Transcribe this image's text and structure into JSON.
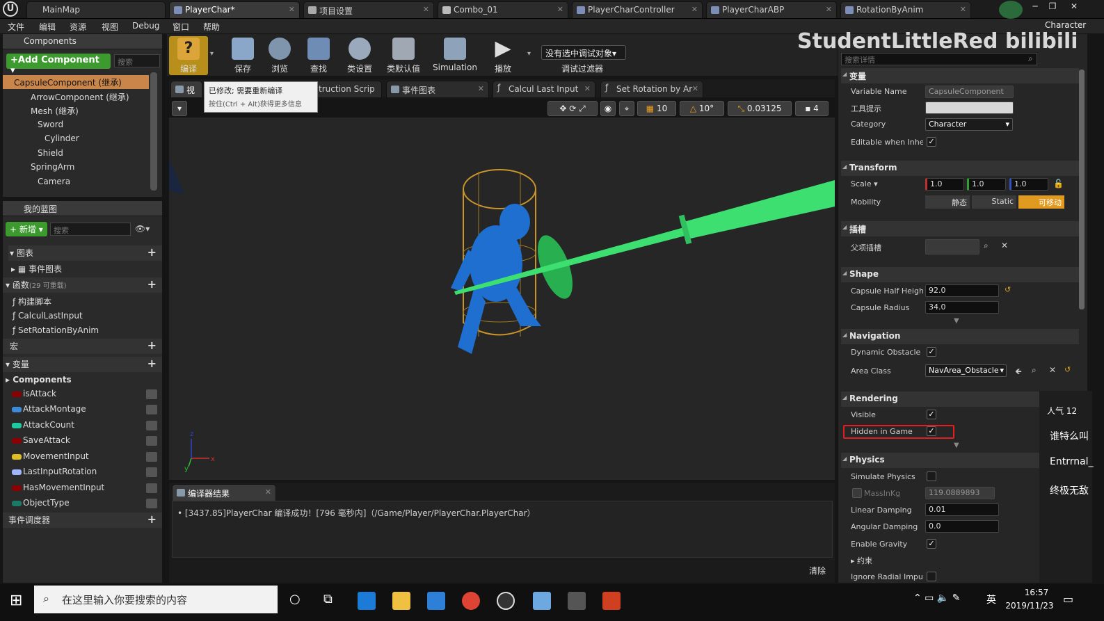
{
  "tabs": [
    "MainMap",
    "PlayerChar*",
    "项目设置",
    "Combo_01",
    "PlayerCharController",
    "PlayerCharABP",
    "RotationByAnim"
  ],
  "parent_class": "Character",
  "watermark": "StudentLittleRed bilibili",
  "menus": [
    "文件",
    "编辑",
    "资源",
    "视图",
    "Debug",
    "窗口",
    "帮助"
  ],
  "components": {
    "title": "Components",
    "add_label": "+Add Component ▾",
    "search_placeholder": "搜索",
    "tree": [
      "CapsuleComponent (继承)",
      "ArrowComponent (继承)",
      "Mesh (继承)",
      "Sword",
      "Cylinder",
      "Shield",
      "SpringArm",
      "Camera"
    ]
  },
  "myblueprint": {
    "title": "我的蓝图",
    "new_label": "新增",
    "search_placeholder": "搜索",
    "graphs": "图表",
    "event_graph": "事件图表",
    "functions": "函数",
    "functions_count": "(29 可重载)",
    "function_items": [
      "构建脚本",
      "CalculLastInput",
      "SetRotationByAnim"
    ],
    "macros": "宏",
    "variables": "变量",
    "components_cat": "Components",
    "vars": [
      {
        "name": "isAttack",
        "color": "#8b0000"
      },
      {
        "name": "AttackMontage",
        "color": "#3d8bd9"
      },
      {
        "name": "AttackCount",
        "color": "#1fc9a0"
      },
      {
        "name": "SaveAttack",
        "color": "#8b0000"
      },
      {
        "name": "MovementInput",
        "color": "#e0c020"
      },
      {
        "name": "LastInputRotation",
        "color": "#a0b4ff"
      },
      {
        "name": "HasMovementInput",
        "color": "#8b0000"
      },
      {
        "name": "ObjectType",
        "color": "#1a7a66"
      }
    ],
    "dispatchers": "事件调度器"
  },
  "toolbar": {
    "compile": "编译",
    "save": "保存",
    "browse": "浏览",
    "find": "查找",
    "class_settings": "类设置",
    "class_defaults": "类默认值",
    "simulation": "Simulation",
    "play": "播放",
    "debug_object": "没有选中调试对象▾",
    "debug_filter": "调试过滤器"
  },
  "tooltip": {
    "line1": "已修改; 需要重新编译",
    "line2": "按住(Ctrl + Alt)获得更多信息"
  },
  "editor_tabs": [
    "视",
    "truction Scrip",
    "事件图表",
    "Calcul Last Input",
    "Set Rotation by Ar"
  ],
  "viewport_controls": {
    "grid": "10",
    "angle": "10°",
    "scale": "0.03125",
    "camera_speed": "4"
  },
  "axis": {
    "x": "x",
    "y": "y",
    "z": "z"
  },
  "compiler": {
    "title": "编译器结果",
    "message": "[3437.85]PlayerChar 编译成功！[796 毫秒内]（/Game/Player/PlayerChar.PlayerChar）",
    "clear": "清除"
  },
  "details": {
    "search_placeholder": "搜索详情",
    "sec_variable": "变量",
    "variable_name_label": "Variable Name",
    "variable_name": "CapsuleComponent",
    "tooltip_label": "工具提示",
    "category_label": "Category",
    "category": "Character",
    "editable_label": "Editable when Inher",
    "sec_transform": "Transform",
    "scale_label": "Scale ▾",
    "scale": [
      "1.0",
      "1.0",
      "1.0"
    ],
    "mobility_label": "Mobility",
    "mobility": [
      "静态",
      "Static",
      "可移动"
    ],
    "sec_sockets": "插槽",
    "parent_socket_label": "父项插槽",
    "sec_shape": "Shape",
    "capsule_half_label": "Capsule Half Heigh",
    "capsule_half": "92.0",
    "capsule_radius_label": "Capsule Radius",
    "capsule_radius": "34.0",
    "sec_navigation": "Navigation",
    "dynamic_obstacle_label": "Dynamic Obstacle",
    "area_class_label": "Area Class",
    "area_class": "NavArea_Obstacle",
    "sec_rendering": "Rendering",
    "visible_label": "Visible",
    "hidden_label": "Hidden in Game",
    "sec_physics": "Physics",
    "simulate_label": "Simulate Physics",
    "mass_label": "MassInKg",
    "mass": "119.0889893",
    "linear_label": "Linear Damping",
    "linear": "0.01",
    "angular_label": "Angular Damping",
    "angular": "0.0",
    "gravity_label": "Enable Gravity",
    "constraints_label": "约束",
    "radial_label": "Ignore Radial Impul"
  },
  "danmaku": [
    "人气 12",
    "谁特么叫",
    "Entrrnal_",
    "终极无敌"
  ],
  "taskbar": {
    "search_placeholder": "在这里输入你要搜索的内容",
    "ime": "英",
    "time": "16:57",
    "date": "2019/11/23"
  },
  "colors": {
    "accent_green": "#3c9a2e",
    "highlight_red": "#e02020",
    "sword_green": "#3de070",
    "char_blue": "#1e6fd0"
  }
}
